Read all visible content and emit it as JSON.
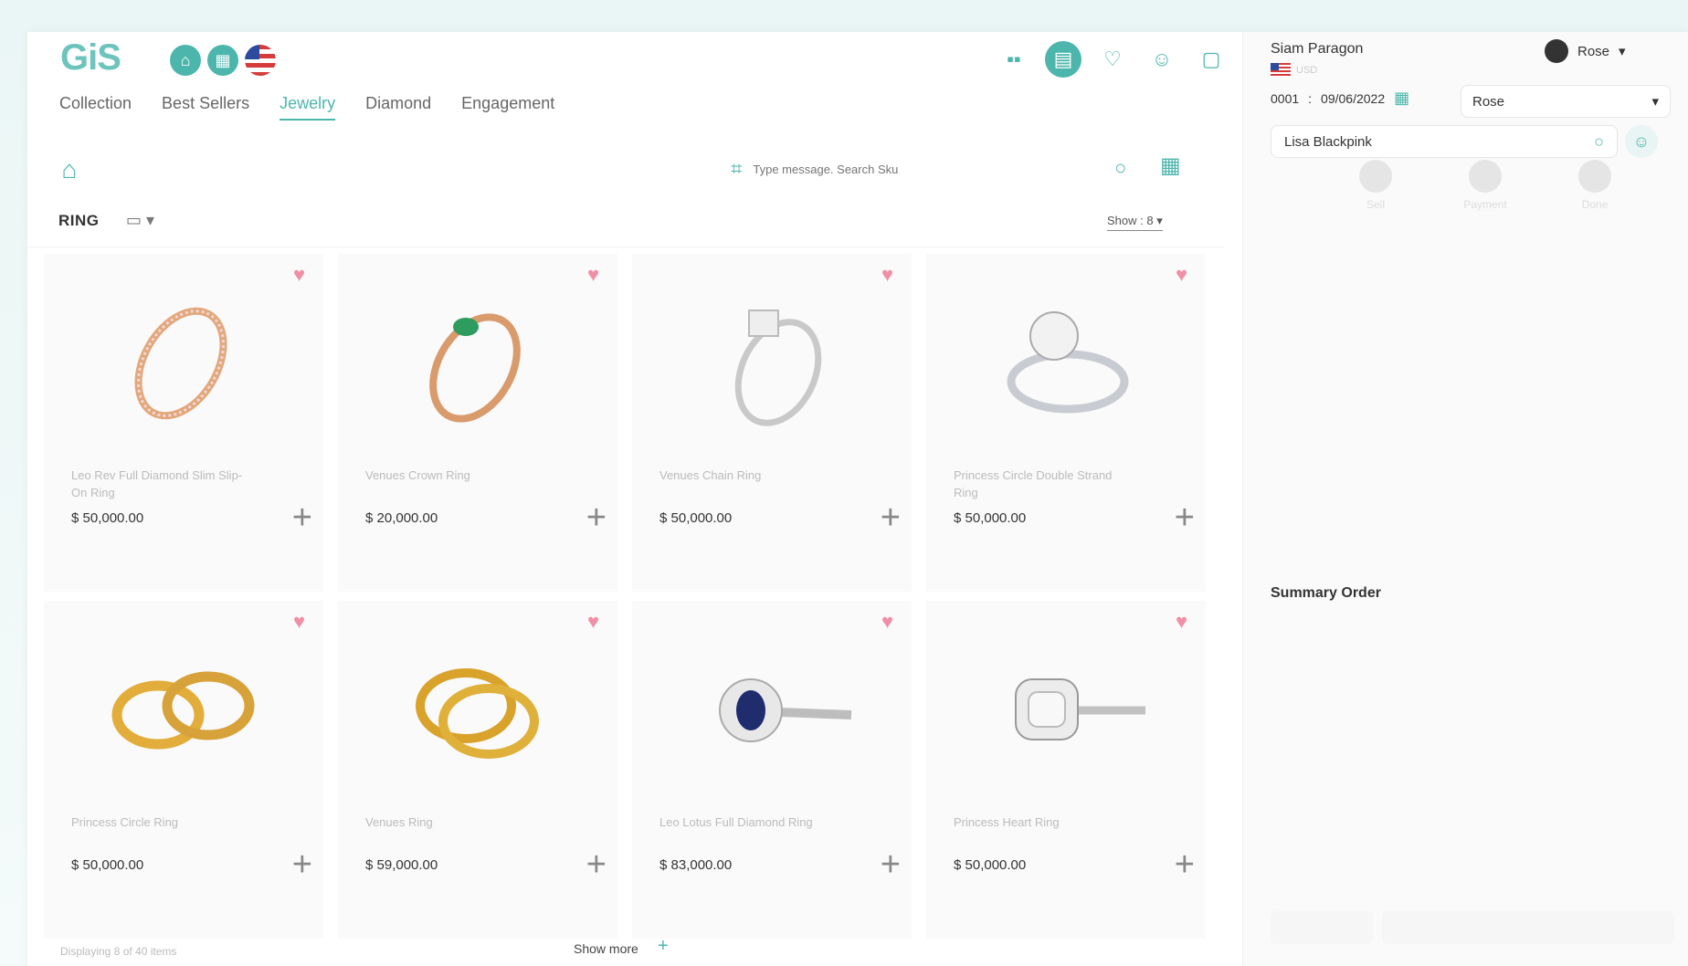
{
  "header": {
    "logo": "GiS",
    "tabs": [
      "Collection",
      "Best Sellers",
      "Jewelry",
      "Diamond",
      "Engagement"
    ],
    "active_tab": 2
  },
  "search": {
    "placeholder": "Type message. Search Sku"
  },
  "filter": {
    "category": "RING",
    "show_label": "Show :",
    "show_value": "8"
  },
  "products": [
    {
      "name": "Leo Rev Full Diamond Slim Slip-On Ring",
      "price": "$ 50,000.00"
    },
    {
      "name": "Venues Crown Ring",
      "price": "$ 20,000.00"
    },
    {
      "name": "Venues Chain Ring",
      "price": "$ 50,000.00"
    },
    {
      "name": "Princess Circle Double Strand Ring",
      "price": "$ 50,000.00"
    },
    {
      "name": "Princess Circle Ring",
      "price": "$ 50,000.00"
    },
    {
      "name": "Venues Ring",
      "price": "$ 59,000.00"
    },
    {
      "name": "Leo Lotus Full Diamond Ring",
      "price": "$ 83,000.00"
    },
    {
      "name": "Princess Heart Ring",
      "price": "$ 50,000.00"
    }
  ],
  "footer": {
    "displaying": "Displaying 8 of 40 items",
    "show_more": "Show more"
  },
  "sidebar": {
    "store": "Siam Paragon",
    "currency": "USD",
    "user": "Rose",
    "order_no": "0001",
    "separator": ":",
    "date": "09/06/2022",
    "staff": "Rose",
    "customer": "Lisa Blackpink",
    "steps": [
      "Sell",
      "Payment",
      "Done"
    ],
    "summary_title": "Summary Order"
  },
  "colors": {
    "accent": "#4db6ac",
    "heart": "#f08fa6"
  }
}
